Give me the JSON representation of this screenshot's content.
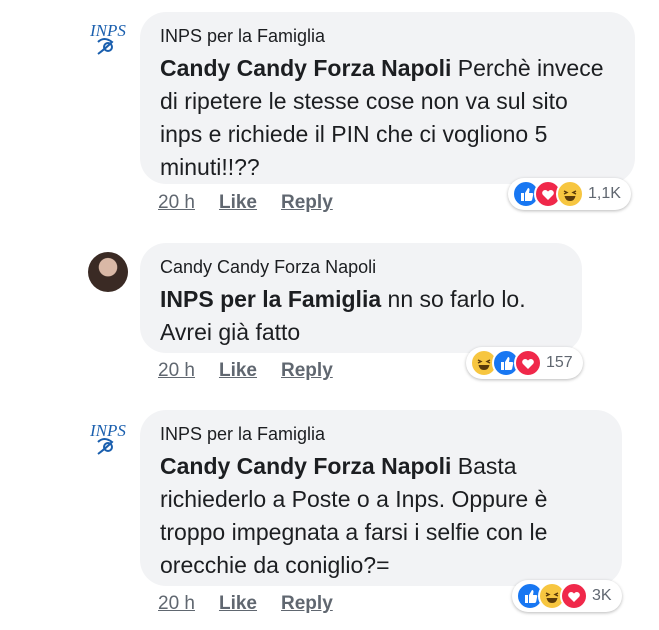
{
  "comments": [
    {
      "author": "INPS per la Famiglia",
      "mention": "Candy Candy Forza Napoli",
      "text": " Perchè invece di ripetere le stesse cose non va sul sito inps e richiede il PIN che ci vogliono 5 minuti!!??",
      "time": "20 h",
      "like": "Like",
      "reply": "Reply",
      "reactions": [
        "like",
        "love",
        "haha"
      ],
      "count": "1,1K"
    },
    {
      "author": "Candy Candy Forza Napoli",
      "mention": "INPS per la Famiglia",
      "text": " nn so farlo lo. Avrei già fatto",
      "time": "20 h",
      "like": "Like",
      "reply": "Reply",
      "reactions": [
        "haha",
        "like",
        "love"
      ],
      "count": "157"
    },
    {
      "author": "INPS per la Famiglia",
      "mention": "Candy Candy Forza Napoli",
      "text": " Basta richiederlo a Poste o a Inps. Oppure è troppo impegnata a farsi i selfie con le orecchie da coniglio?=",
      "time": "20 h",
      "like": "Like",
      "reply": "Reply",
      "reactions": [
        "like",
        "haha",
        "love"
      ],
      "count": "3K"
    }
  ],
  "colors": {
    "like": "#1877f2",
    "love": "#f0284a",
    "haha": "#f7c640",
    "inps_logo": "#1a5fae"
  }
}
